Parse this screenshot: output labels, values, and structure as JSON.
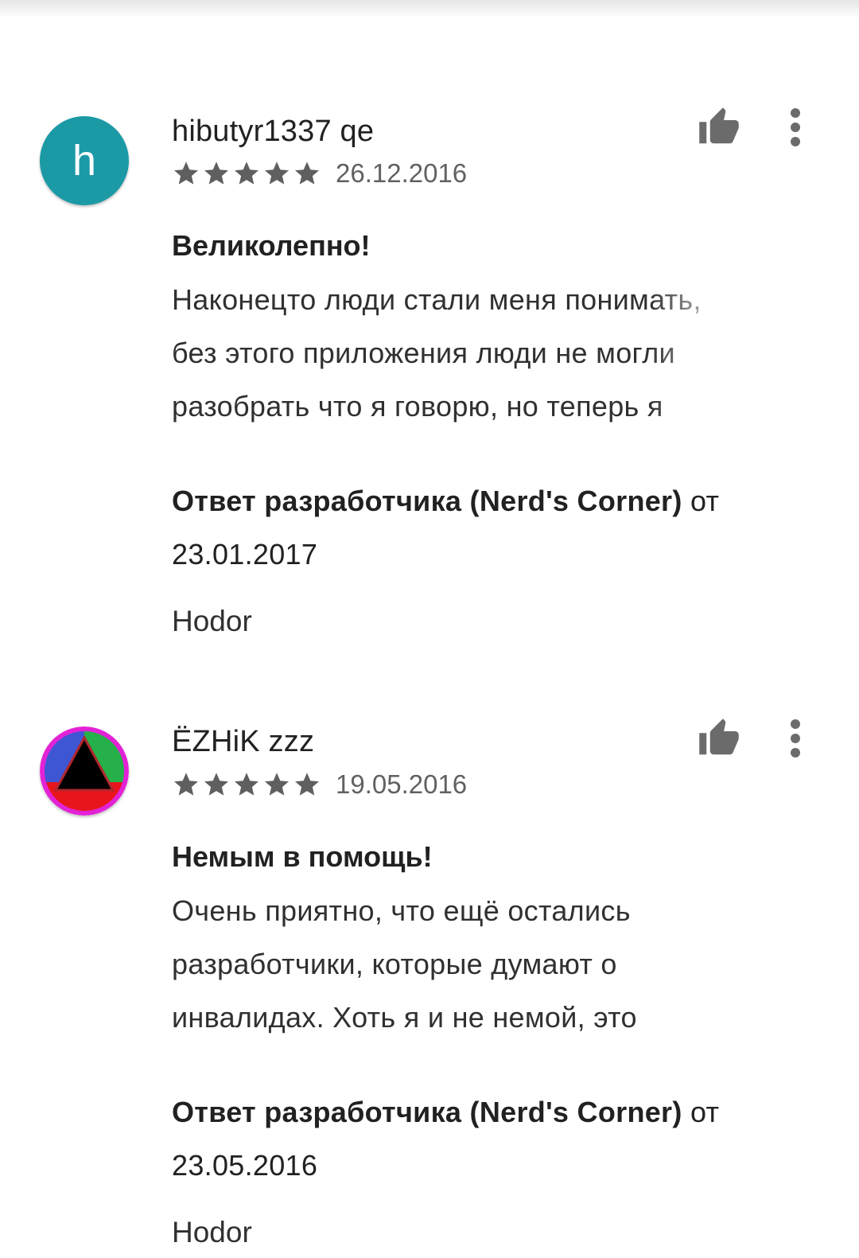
{
  "reviews": [
    {
      "author": "hibutyr1337 qe",
      "avatar_letter": "h",
      "rating": 5,
      "date": "26.12.2016",
      "title": "Великолепно!",
      "body_lines": [
        "Наконецто люди стали меня понимать,",
        "без этого приложения люди не могли",
        "разобрать что я говорю, но теперь я"
      ],
      "developer_reply": {
        "label": "Ответ разработчика (Nerd's Corner)",
        "date_prefix": "от",
        "date": "23.01.2017",
        "text": "Hodor"
      }
    },
    {
      "author": "ËZHiK zzz",
      "rating": 5,
      "date": "19.05.2016",
      "title": "Немым в помощь!",
      "body_lines": [
        "Очень приятно, что ещё остались",
        "разработчики, которые думают о",
        "инвалидах. Хоть я и не немой, это"
      ],
      "developer_reply": {
        "label": "Ответ разработчика (Nerd's Corner)",
        "date_prefix": "от",
        "date": "23.05.2016",
        "text": "Hodor"
      }
    }
  ],
  "colors": {
    "avatar_teal": "#1b9aa6",
    "star_gray": "#5f5f5f",
    "icon_gray": "#6b6b6b"
  },
  "icons": {
    "like": "thumb-up-icon",
    "more": "more-vert-icon",
    "star": "star-icon"
  }
}
